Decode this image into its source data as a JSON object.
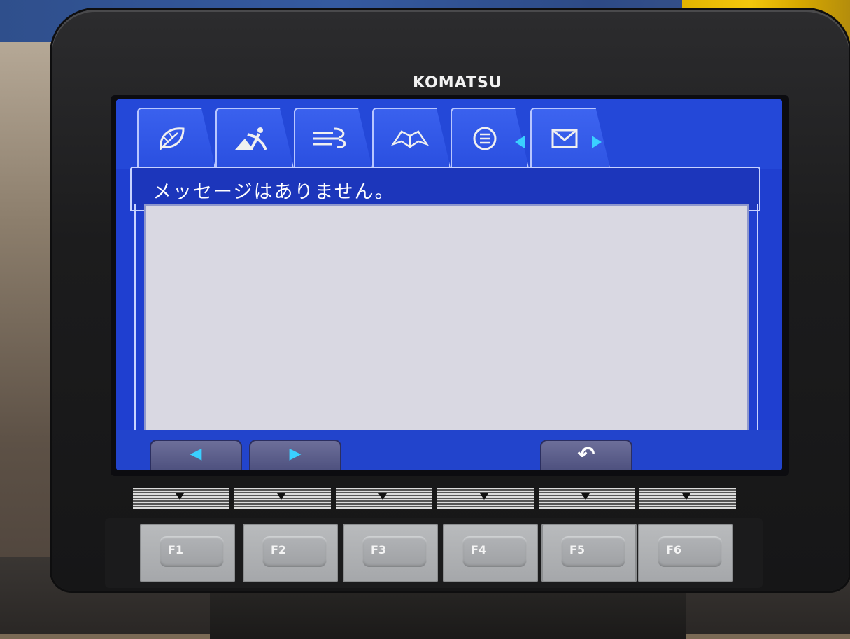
{
  "device": {
    "brand": "KOMATSU"
  },
  "tabs": [
    {
      "name": "eco",
      "icon": "leaf-icon"
    },
    {
      "name": "work-mode",
      "icon": "excavator-worker-icon"
    },
    {
      "name": "breaker",
      "icon": "air-flow-icon"
    },
    {
      "name": "manual",
      "icon": "book-icon"
    },
    {
      "name": "menu",
      "icon": "list-menu-icon"
    },
    {
      "name": "messages",
      "icon": "envelope-icon",
      "active": true
    }
  ],
  "message_screen": {
    "status_text": "メッセージはありません。"
  },
  "softkeys": [
    {
      "name": "previous",
      "icon": "left-arrow-icon"
    },
    {
      "name": "next",
      "icon": "right-arrow-icon"
    },
    {
      "name": "return",
      "icon": "return-icon"
    }
  ],
  "function_keys": [
    "F1",
    "F2",
    "F3",
    "F4",
    "F5",
    "F6"
  ],
  "colors": {
    "screen_blue": "#1f3fd0",
    "accent_cyan": "#3ad0ff",
    "content_bg": "#d9d8e2"
  }
}
